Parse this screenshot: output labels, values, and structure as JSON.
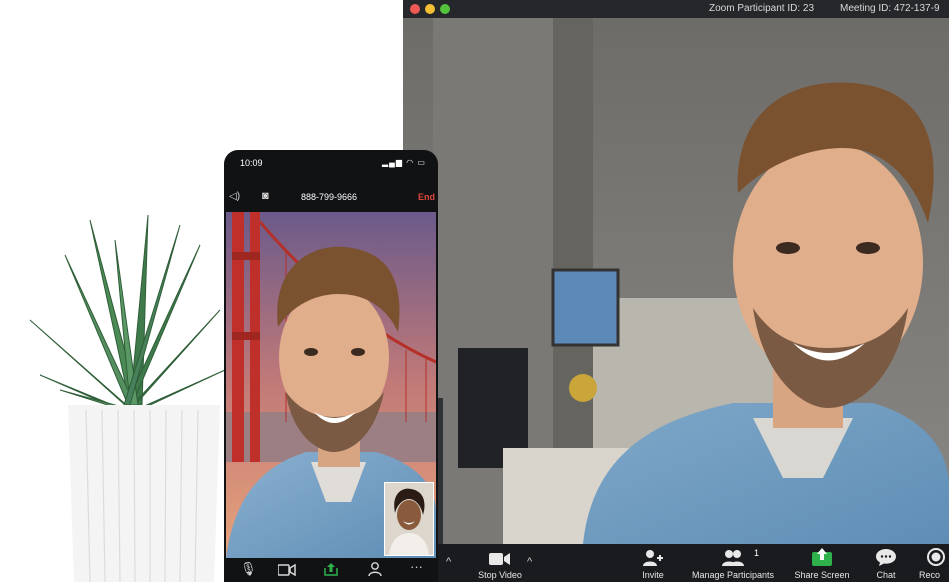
{
  "desktop": {
    "title": {
      "participant_id": "Zoom Participant ID: 23",
      "meeting_id": "Meeting ID: 472-137-9"
    },
    "toolbar": {
      "stop_video": "Stop Video",
      "invite": "Invite",
      "manage_participants": "Manage Participants",
      "participants_count": "1",
      "share_screen": "Share Screen",
      "chat": "Chat",
      "record": "Reco"
    }
  },
  "phone": {
    "time": "10:09",
    "status_icons": "▂▄▆ ◠ ▭",
    "phone_number": "888-799-9666",
    "end_label": "End"
  },
  "colors": {
    "share_green": "#2fb24c",
    "end_red": "#e0463c",
    "toolbar_bg": "#1a1b1e"
  }
}
